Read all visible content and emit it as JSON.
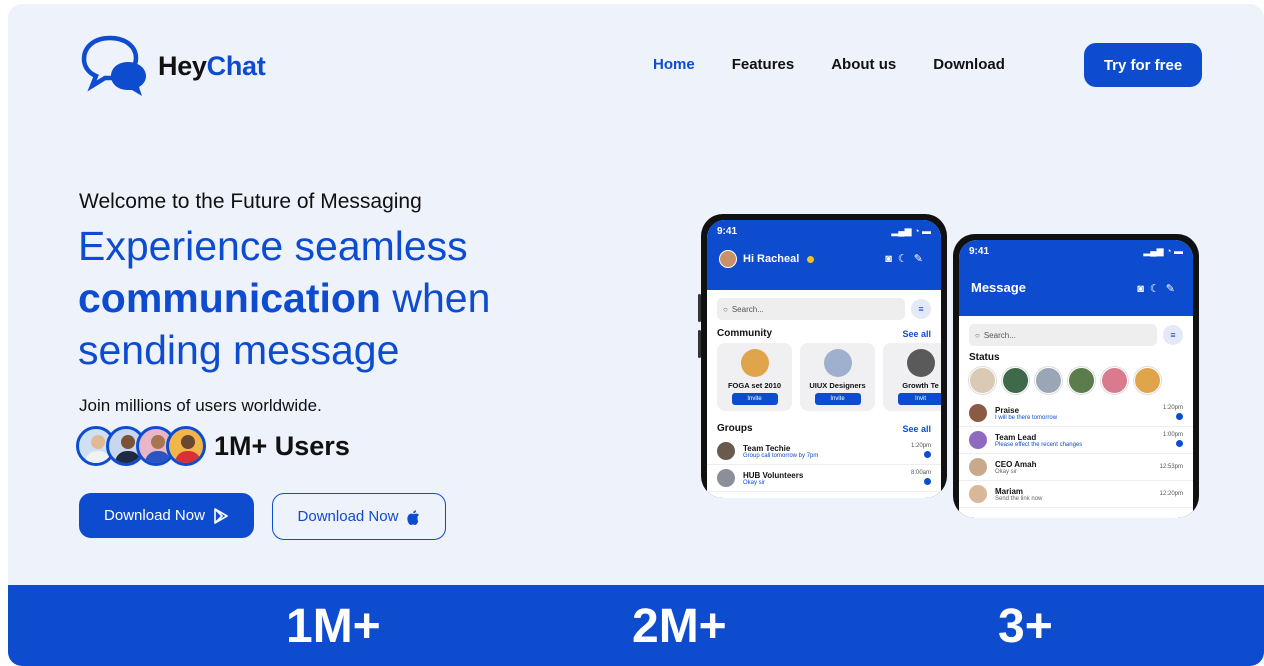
{
  "brand": {
    "name_a": "Hey",
    "name_b": "Chat"
  },
  "nav": {
    "items": [
      {
        "label": "Home",
        "active": true
      },
      {
        "label": "Features",
        "active": false
      },
      {
        "label": "About us",
        "active": false
      },
      {
        "label": "Download",
        "active": false
      }
    ],
    "cta": "Try for free"
  },
  "hero": {
    "eyebrow": "Welcome to the Future of Messaging",
    "headline_1": "Experience seamless",
    "headline_bold": "communication",
    "headline_2": " when",
    "headline_3": "sending message",
    "join": "Join millions of users worldwide.",
    "users_count": "1M+ Users",
    "download_play": "Download Now",
    "download_apple": "Download Now"
  },
  "phone1": {
    "time": "9:41",
    "greeting": "Hi Racheal",
    "search_placeholder": "Search...",
    "community_title": "Community",
    "see_all": "See all",
    "communities": [
      {
        "name": "FOGA set 2010",
        "action": "Invite"
      },
      {
        "name": "UIUX Designers",
        "action": "Invite"
      },
      {
        "name": "Growth Te",
        "action": "Invit"
      }
    ],
    "groups_title": "Groups",
    "groups_see_all": "See all",
    "groups": [
      {
        "name": "Team Techie",
        "sub": "Group call tomorrow by 7pm",
        "time": "1:20pm"
      },
      {
        "name": "HUB Volunteers",
        "sub": "Okay sir",
        "time": "8:00am"
      }
    ]
  },
  "phone2": {
    "time": "9:41",
    "title": "Message",
    "search_placeholder": "Search...",
    "status_title": "Status",
    "chats": [
      {
        "name": "Praise",
        "sub": "I will be there tomorrow",
        "time": "1:20pm"
      },
      {
        "name": "Team Lead",
        "sub": "Please effect the recent changes",
        "time": "1:00pm"
      },
      {
        "name": "CEO Amah",
        "sub": "Okay sir",
        "time": "12:53pm"
      },
      {
        "name": "Mariam",
        "sub": "Send the link now",
        "time": "12:20pm"
      }
    ]
  },
  "stats": [
    "1M+",
    "2M+",
    "3+"
  ],
  "colors": {
    "primary": "#0e4ccf",
    "background": "#eef2fb"
  },
  "icons": [
    "chat-bubbles-logo-icon",
    "play-store-icon",
    "apple-icon",
    "camera-icon",
    "moon-icon",
    "edit-icon",
    "search-icon",
    "filter-icon"
  ]
}
